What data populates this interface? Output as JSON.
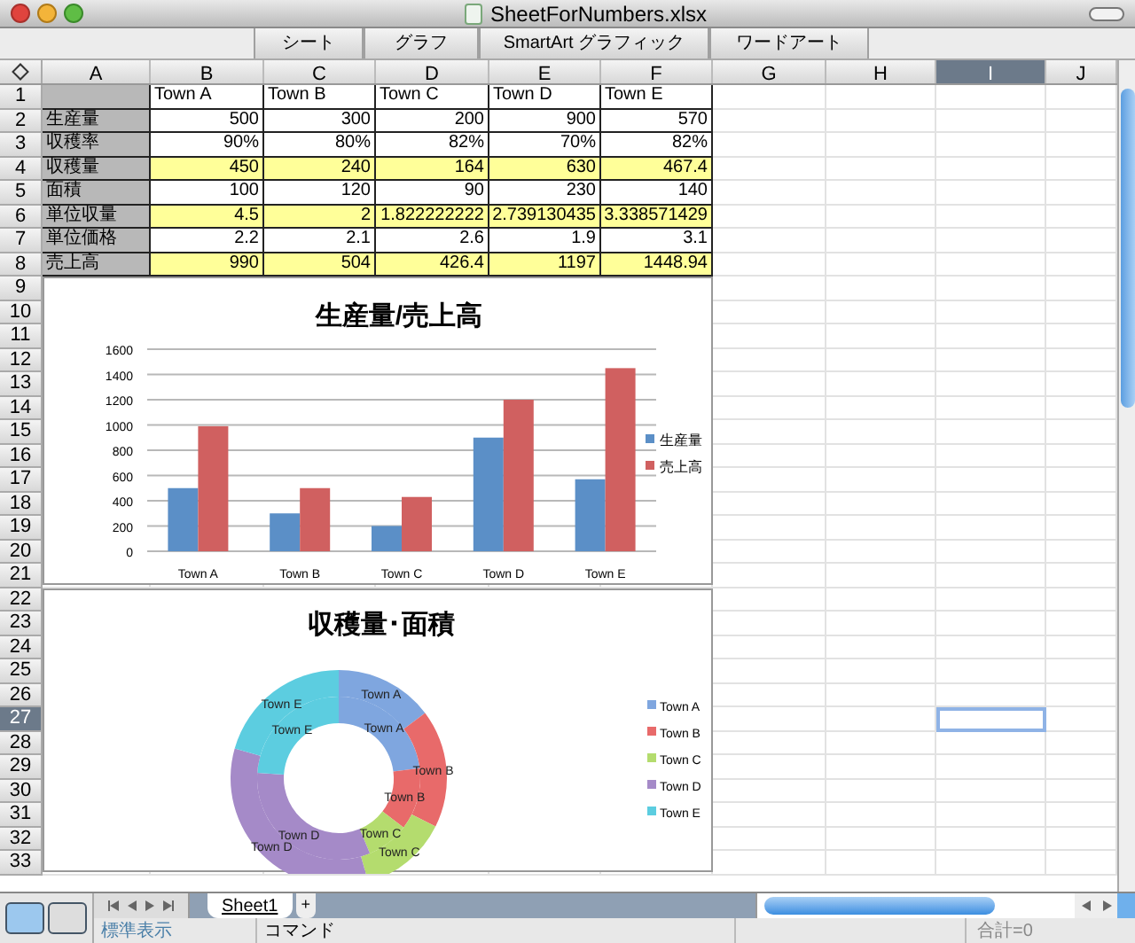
{
  "window": {
    "title": "SheetForNumbers.xlsx"
  },
  "ribbon_tabs": [
    {
      "label": "シート"
    },
    {
      "label": "グラフ"
    },
    {
      "label": "SmartArt グラフィック"
    },
    {
      "label": "ワードアート"
    }
  ],
  "columns": [
    {
      "label": "A",
      "selected": false
    },
    {
      "label": "B",
      "selected": false
    },
    {
      "label": "C",
      "selected": false
    },
    {
      "label": "D",
      "selected": false
    },
    {
      "label": "E",
      "selected": false
    },
    {
      "label": "F",
      "selected": false
    },
    {
      "label": "G",
      "selected": false
    },
    {
      "label": "H",
      "selected": false
    },
    {
      "label": "I",
      "selected": true
    },
    {
      "label": "J",
      "selected": false
    }
  ],
  "row_numbers": [
    {
      "label": "1",
      "selected": false
    },
    {
      "label": "2",
      "selected": false
    },
    {
      "label": "3",
      "selected": false
    },
    {
      "label": "4",
      "selected": false
    },
    {
      "label": "5",
      "selected": false
    },
    {
      "label": "6",
      "selected": false
    },
    {
      "label": "7",
      "selected": false
    },
    {
      "label": "8",
      "selected": false
    },
    {
      "label": "9",
      "selected": false
    },
    {
      "label": "10",
      "selected": false
    },
    {
      "label": "11",
      "selected": false
    },
    {
      "label": "12",
      "selected": false
    },
    {
      "label": "13",
      "selected": false
    },
    {
      "label": "14",
      "selected": false
    },
    {
      "label": "15",
      "selected": false
    },
    {
      "label": "16",
      "selected": false
    },
    {
      "label": "17",
      "selected": false
    },
    {
      "label": "18",
      "selected": false
    },
    {
      "label": "19",
      "selected": false
    },
    {
      "label": "20",
      "selected": false
    },
    {
      "label": "21",
      "selected": false
    },
    {
      "label": "22",
      "selected": false
    },
    {
      "label": "23",
      "selected": false
    },
    {
      "label": "24",
      "selected": false
    },
    {
      "label": "25",
      "selected": false
    },
    {
      "label": "26",
      "selected": false
    },
    {
      "label": "27",
      "selected": true
    },
    {
      "label": "28",
      "selected": false
    },
    {
      "label": "29",
      "selected": false
    },
    {
      "label": "30",
      "selected": false
    },
    {
      "label": "31",
      "selected": false
    },
    {
      "label": "32",
      "selected": false
    },
    {
      "label": "33",
      "selected": false
    }
  ],
  "table": {
    "rows": [
      {
        "highlighted": false,
        "cells": [
          "",
          "Town A",
          "Town B",
          "Town C",
          "Town D",
          "Town E"
        ]
      },
      {
        "highlighted": false,
        "cells": [
          "生産量",
          "500",
          "300",
          "200",
          "900",
          "570"
        ]
      },
      {
        "highlighted": false,
        "cells": [
          "収穫率",
          "90%",
          "80%",
          "82%",
          "70%",
          "82%"
        ]
      },
      {
        "highlighted": true,
        "cells": [
          "収穫量",
          "450",
          "240",
          "164",
          "630",
          "467.4"
        ]
      },
      {
        "highlighted": false,
        "cells": [
          "面積",
          "100",
          "120",
          "90",
          "230",
          "140"
        ]
      },
      {
        "highlighted": true,
        "cells": [
          "単位収量",
          "4.5",
          "2",
          "1.822222222",
          "2.739130435",
          "3.338571429"
        ]
      },
      {
        "highlighted": false,
        "cells": [
          "単位価格",
          "2.2",
          "2.1",
          "2.6",
          "1.9",
          "3.1"
        ]
      },
      {
        "highlighted": true,
        "cells": [
          "売上高",
          "990",
          "504",
          "426.4",
          "1197",
          "1448.94"
        ]
      }
    ]
  },
  "bar_chart": {
    "chart_data": {
      "type": "bar",
      "title": "生産量/売上高",
      "categories": [
        "Town A",
        "Town B",
        "Town C",
        "Town D",
        "Town E"
      ],
      "series": [
        {
          "name": "生産量",
          "color": "#5b8fc7",
          "values": [
            500,
            300,
            200,
            900,
            570
          ]
        },
        {
          "name": "売上高",
          "color": "#d06060",
          "values": [
            990,
            500,
            430,
            1200,
            1450
          ]
        }
      ],
      "ylim": [
        0,
        1600
      ],
      "yticks": [
        0,
        200,
        400,
        600,
        800,
        1000,
        1200,
        1400,
        1600
      ],
      "grid": true,
      "legend": true
    }
  },
  "donut_chart": {
    "chart_data": {
      "type": "donut",
      "title": "収穫量･面積",
      "categories": [
        "Town A",
        "Town B",
        "Town C",
        "Town D",
        "Town E"
      ],
      "colors": [
        "#7fa6df",
        "#e86a6a",
        "#b4dc6e",
        "#a58ac8",
        "#5ccde0"
      ],
      "series": [
        {
          "values": [
            23.06,
            12.3,
            8.4,
            32.28,
            23.96
          ]
        },
        {
          "values": [
            14.71,
            17.65,
            13.24,
            33.82,
            20.58
          ]
        }
      ],
      "legend": true
    },
    "ring_labels": [
      {
        "labels": [
          "Town A",
          "Town B",
          "Town C",
          "Town D",
          "Town E"
        ]
      },
      {
        "labels": [
          "Town A",
          "Town B",
          "Town C",
          "Town D",
          "Town E"
        ]
      }
    ]
  },
  "view_buttons": [
    {
      "selected": true
    },
    {
      "selected": false
    }
  ],
  "sheet_tabs": [
    {
      "label": "Sheet1",
      "selected": true
    }
  ],
  "add_sheet": "+",
  "status_bar": {
    "view": "標準表示",
    "mode": "コマンド",
    "sum": "合計=0"
  }
}
